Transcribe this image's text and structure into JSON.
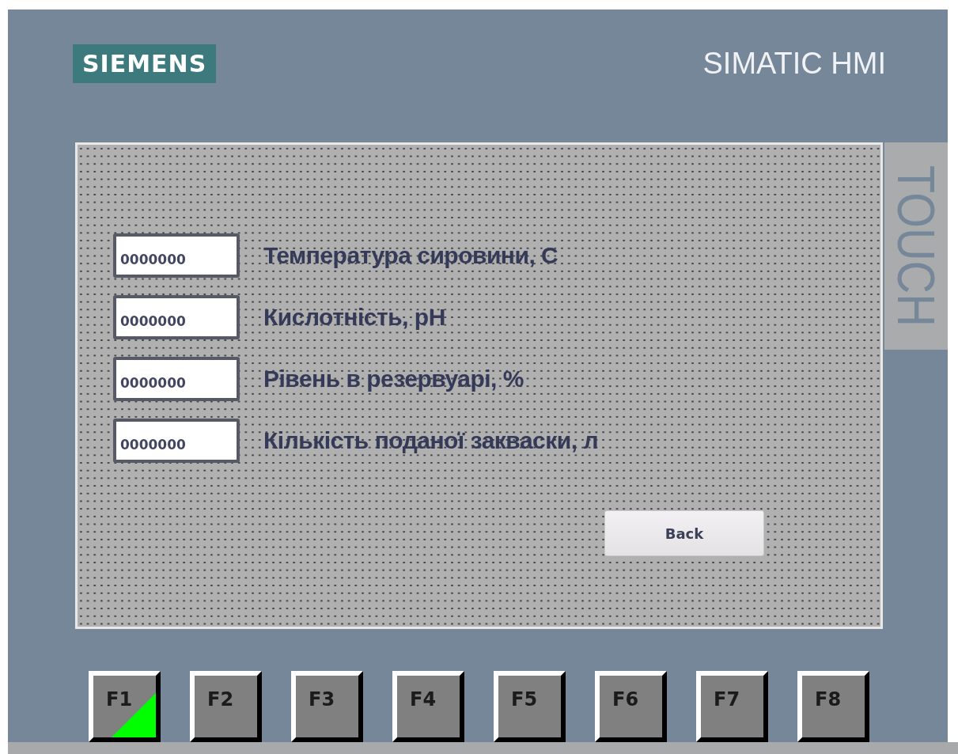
{
  "device": {
    "brand": "SIEMENS",
    "model": "SIMATIC HMI",
    "side_label": "TOUCH"
  },
  "fields": [
    {
      "value": "0000000",
      "label": "Температура сировини, С"
    },
    {
      "value": "0000000",
      "label": "Кислотність, pH"
    },
    {
      "value": "0000000",
      "label": "Рівень в резервуарі, %"
    },
    {
      "value": "0000000",
      "label": "Кількість поданої закваски, л"
    }
  ],
  "back_button": "Back",
  "function_keys": [
    {
      "label": "F1",
      "active": true
    },
    {
      "label": "F2",
      "active": false
    },
    {
      "label": "F3",
      "active": false
    },
    {
      "label": "F4",
      "active": false
    },
    {
      "label": "F5",
      "active": false
    },
    {
      "label": "F6",
      "active": false
    },
    {
      "label": "F7",
      "active": false
    },
    {
      "label": "F8",
      "active": false
    }
  ]
}
